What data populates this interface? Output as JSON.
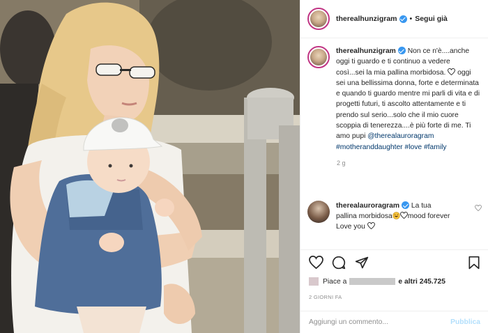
{
  "header": {
    "username": "therealhunzigram",
    "follow_label": "Segui già",
    "separator": "•"
  },
  "caption": {
    "username": "therealhunzigram",
    "text_1": "Non ce n'è....anche oggi ti guardo e ti continuo a vedere così...sei la mia pallina morbidosa. ",
    "text_2": " oggi sei una bellissima donna, forte e determinata e quando ti guardo mentre mi parli di vita e di progetti futuri, ti ascolto attentamente e ti prendo sul serio...solo che il mio cuore scoppia di tenerezza....è più forte di me. Ti amo pupi ",
    "mention": "@therealauroragram",
    "hashtags": "#motheranddaughter #love #family",
    "time": "2 g"
  },
  "reply": {
    "username": "therealauroragram",
    "text_1": "La tua pallina morbidosa",
    "text_2": "mood forever",
    "text_3": "Love you "
  },
  "likes": {
    "prefix": "Piace a",
    "suffix": "e altri",
    "count": "245.725"
  },
  "date": "2 GIORNI FA",
  "comment_box": {
    "placeholder": "Aggiungi un commento...",
    "publish_label": "Pubblica"
  },
  "icons": {
    "verified": "verified-badge-icon",
    "like": "heart-icon",
    "comment": "comment-icon",
    "share": "paper-plane-icon",
    "save": "bookmark-icon",
    "emoji": "laughing-emoji-icon"
  },
  "colors": {
    "verified_blue": "#3897f0",
    "link": "#00376b",
    "muted": "#8e8e8e",
    "publish_disabled": "#b2dffc"
  }
}
